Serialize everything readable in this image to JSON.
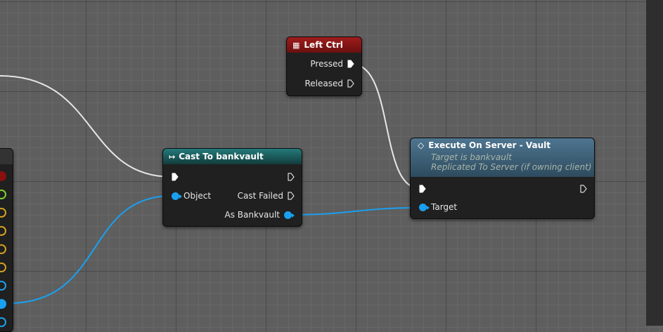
{
  "nodes": {
    "left_ctrl": {
      "title": "Left Ctrl",
      "icon": "keyboard-icon",
      "header_color": "#8a1515",
      "pins": {
        "pressed": "Pressed",
        "released": "Released"
      }
    },
    "cast": {
      "title": "Cast To bankvault",
      "icon": "cast-arrow-icon",
      "header_color": "#1b6a6a",
      "pins": {
        "object": "Object",
        "cast_failed": "Cast Failed",
        "as_bankvault": "As Bankvault"
      }
    },
    "execute": {
      "title": "Execute On Server - Vault",
      "icon": "function-icon",
      "header_color": "#3f6580",
      "subtitle1": "Target is bankvault",
      "subtitle2": "Replicated To Server (if owning client)",
      "pins": {
        "target": "Target"
      }
    }
  },
  "colors": {
    "exec_wire": "#e8e8e8",
    "object_wire": "#1aa0f0",
    "pin_red": "#8a1010",
    "pin_green": "#7fd030",
    "pin_yellow": "#d4a020",
    "pin_blue": "#1aa0f0"
  }
}
